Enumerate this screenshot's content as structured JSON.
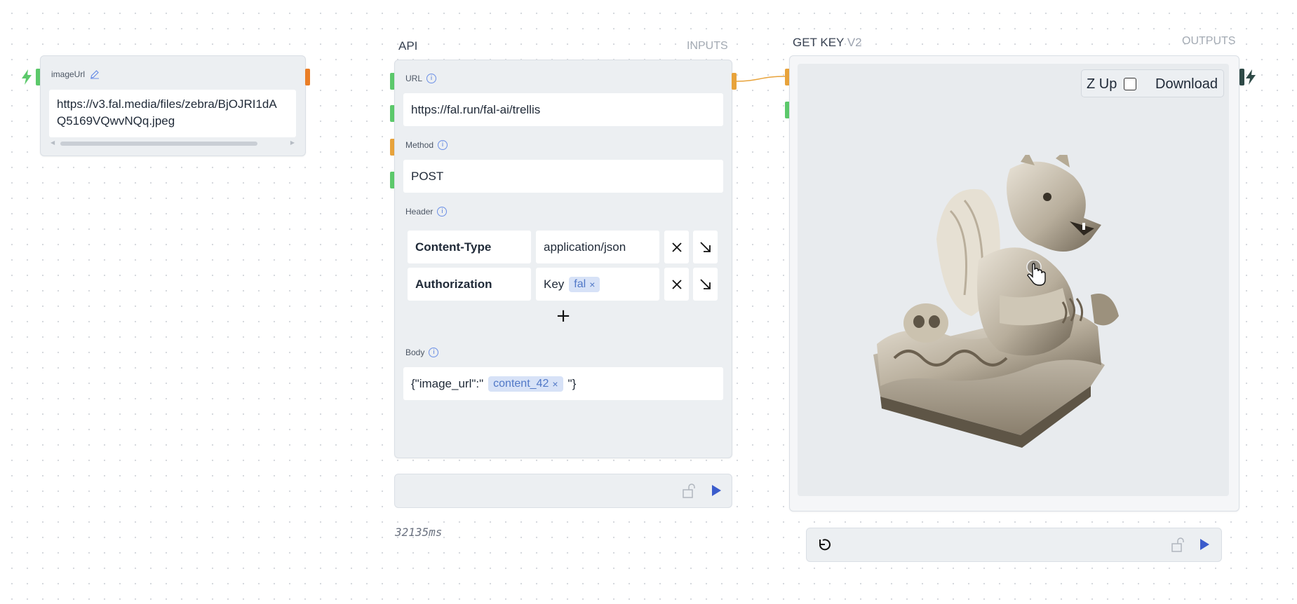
{
  "image_url_node": {
    "title": "imageUrl",
    "value_line1": "https://v3.fal.media/files/zebra/BjOJRI1dA",
    "value_line2": "Q5169VQwvNQq.jpeg"
  },
  "api_node": {
    "title": "API",
    "inputs_label": "INPUTS",
    "url_label": "URL",
    "url_value": "https://fal.run/fal-ai/trellis",
    "method_label": "Method",
    "method_value": "POST",
    "header_label": "Header",
    "headers": [
      {
        "key": "Content-Type",
        "value": "application/json"
      },
      {
        "key": "Authorization",
        "value_prefix": "Key",
        "chip": "fal"
      }
    ],
    "add_label": "+",
    "body_label": "Body",
    "body_prefix": "{\"image_url\":\"",
    "body_chip": "content_42",
    "body_suffix": "\"}",
    "timing": "32135ms"
  },
  "get_key_node": {
    "title": "GET KEY",
    "version": "V2",
    "outputs_label": "OUTPUTS",
    "z_up_label": "Z Up",
    "download_label": "Download"
  },
  "icons": {
    "remove": "×",
    "chip_remove": "×"
  },
  "colors": {
    "port_green": "#5cc96b",
    "port_orange": "#e8a33b",
    "port_dark": "#2f4a47",
    "play_blue": "#3b5ccc",
    "chip_bg": "#d7e2f7"
  }
}
